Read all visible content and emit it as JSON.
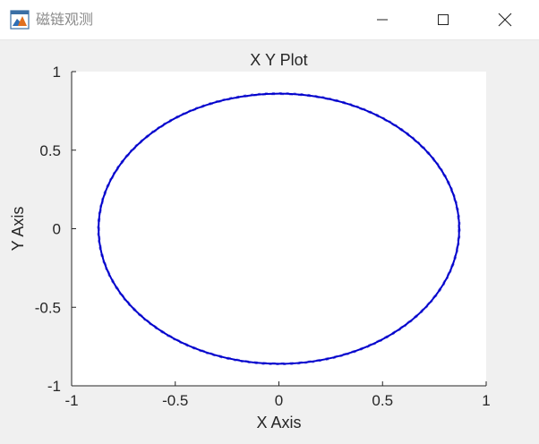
{
  "window": {
    "title": "磁链观测",
    "icon": "matlab-figure-icon",
    "controls": [
      "minimize-icon",
      "maximize-icon",
      "close-icon"
    ]
  },
  "chart_data": {
    "type": "line",
    "title": "X Y Plot",
    "xlabel": "X Axis",
    "ylabel": "Y Axis",
    "xlim": [
      -1,
      1
    ],
    "ylim": [
      -1,
      1
    ],
    "xticks": [
      -1,
      -0.5,
      0,
      0.5,
      1
    ],
    "xtick_labels": [
      "-1",
      "-0.5",
      "0",
      "0.5",
      "1"
    ],
    "yticks": [
      -1,
      -0.5,
      0,
      0.5,
      1
    ],
    "ytick_labels": [
      "-1",
      "-0.5",
      "0",
      "0.5",
      "1"
    ],
    "grid": false,
    "series": [
      {
        "color": "#0000cc",
        "shape": "ellipse",
        "center": [
          0,
          0
        ],
        "x_radius": 0.87,
        "y_radius": 0.86
      }
    ]
  },
  "colors": {
    "axes_background": "#ffffff",
    "figure_background": "#f0f0f0",
    "axis_color": "#262626",
    "line_color": "#0000cc"
  }
}
